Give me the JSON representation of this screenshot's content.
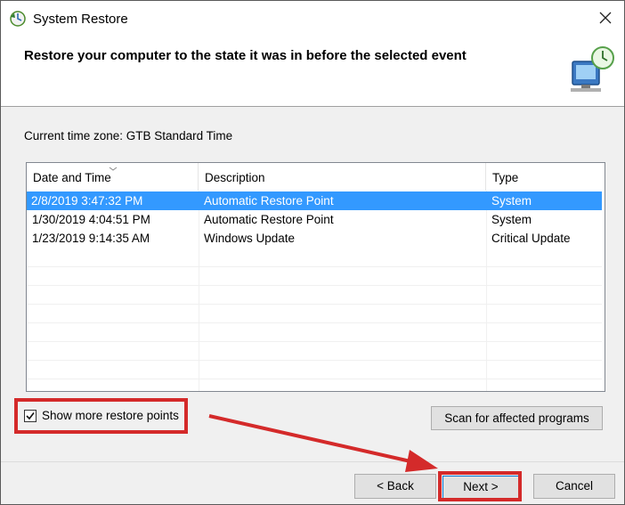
{
  "window": {
    "title": "System Restore",
    "heading": "Restore your computer to the state it was in before the selected event"
  },
  "timezone_label": "Current time zone: GTB Standard Time",
  "list": {
    "columns": [
      "Date and Time",
      "Description",
      "Type"
    ],
    "rows": [
      {
        "date": "2/8/2019 3:47:32 PM",
        "description": "Automatic Restore Point",
        "type": "System",
        "selected": true
      },
      {
        "date": "1/30/2019 4:04:51 PM",
        "description": "Automatic Restore Point",
        "type": "System",
        "selected": false
      },
      {
        "date": "1/23/2019 9:14:35 AM",
        "description": "Windows Update",
        "type": "Critical Update",
        "selected": false
      }
    ]
  },
  "show_more": {
    "label": "Show more restore points",
    "checked": true
  },
  "buttons": {
    "scan": "Scan for affected programs",
    "back": "< Back",
    "next": "Next >",
    "cancel": "Cancel"
  },
  "colors": {
    "selection": "#3399ff",
    "annotation": "#d42a2a"
  },
  "icons": {
    "app": "system-restore-icon",
    "header": "monitor-clock-icon",
    "close": "close-icon"
  }
}
